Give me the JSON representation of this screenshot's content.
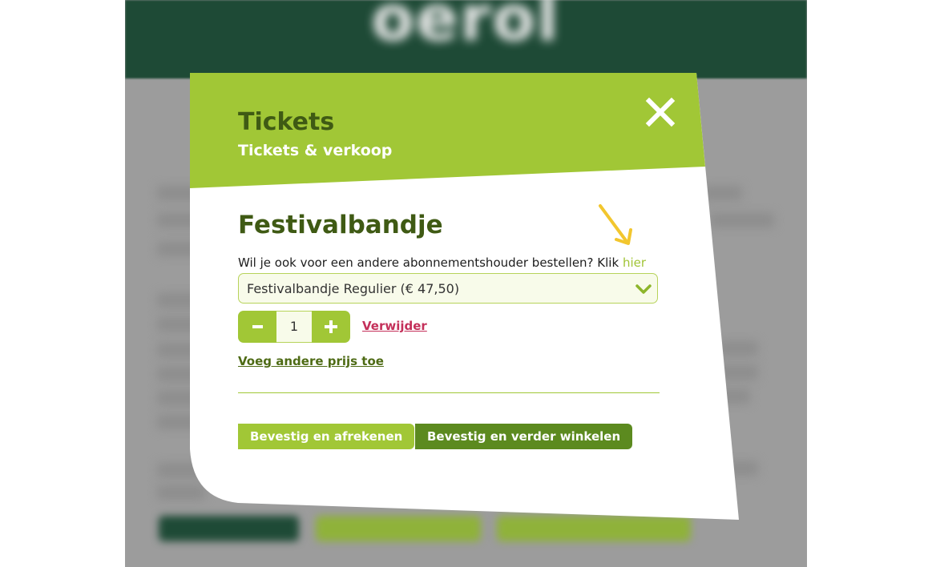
{
  "background": {
    "header_color": "#1e4a36",
    "logo_text": "oerol"
  },
  "modal": {
    "heading": "Tickets",
    "subheading": "Tickets & verkoop",
    "close_icon": "close-icon",
    "accent_color": "#a1c736",
    "dark_green": "#3f5a14"
  },
  "product": {
    "title": "Festivalbandje",
    "help_text": "Wil je ook voor een andere abonnementshouder bestellen? Klik",
    "help_link": "hier",
    "selected_option": "Festivalbandje Regulier (€ 47,50)",
    "quantity": "1",
    "remove_label": "Verwijder",
    "add_price_label": "Voeg andere prijs toe"
  },
  "actions": {
    "checkout_label": "Bevestig en afrekenen",
    "continue_label": "Bevestig en verder winkelen"
  }
}
